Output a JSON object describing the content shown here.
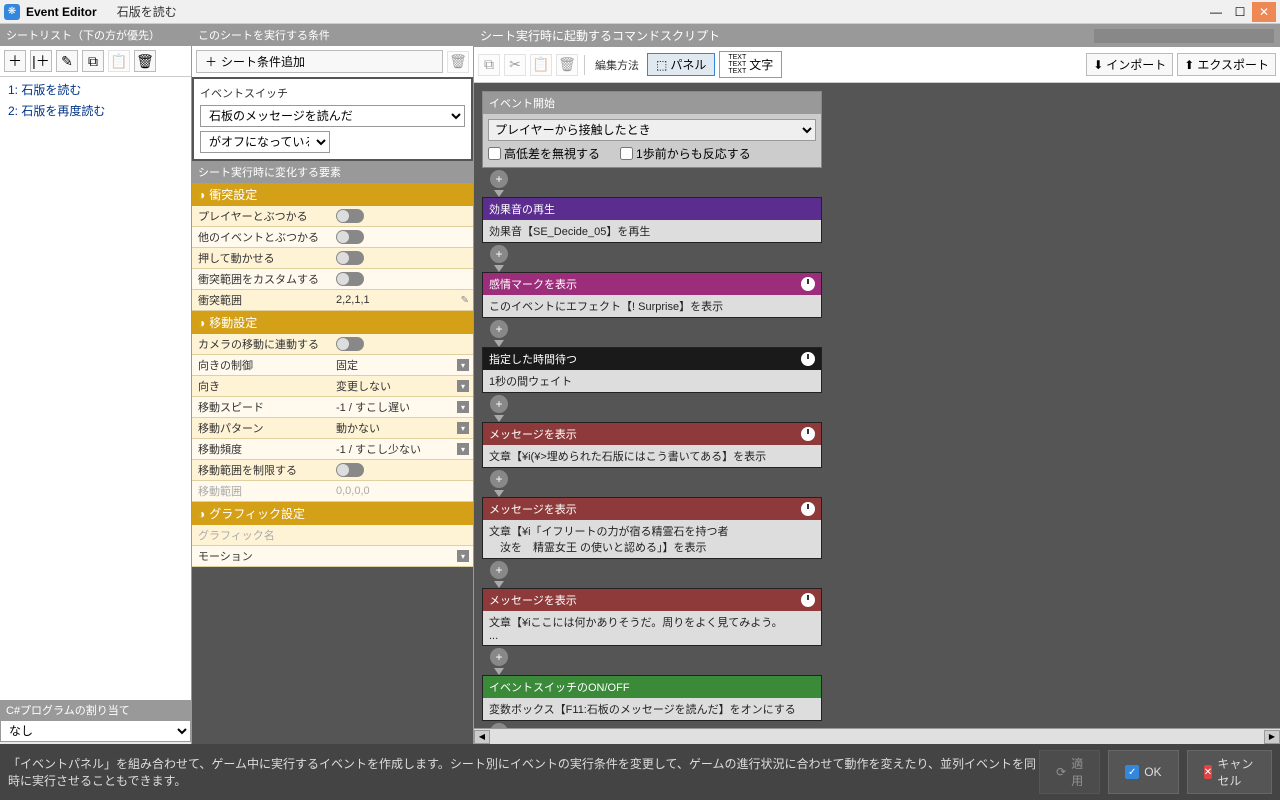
{
  "titlebar": {
    "app": "Event Editor",
    "event_name": "石版を読む"
  },
  "left": {
    "header": "シートリスト（下の方が優先）",
    "sheets": [
      {
        "idx": "1:",
        "name": "石版を読む"
      },
      {
        "idx": "2:",
        "name": "石版を再度読む"
      }
    ],
    "csharp_header": "C#プログラムの割り当て",
    "csharp_value": "なし"
  },
  "mid": {
    "cond_header": "このシートを実行する条件",
    "add_cond": "シート条件追加",
    "cond_box_label": "イベントスイッチ",
    "cond_switch": "石板のメッセージを読んだ",
    "cond_state": "がオフになっている",
    "change_header": "シート実行時に変化する要素",
    "collision_header": "衝突設定",
    "collision_rows": [
      {
        "label": "プレイヤーとぶつかる",
        "type": "toggle"
      },
      {
        "label": "他のイベントとぶつかる",
        "type": "toggle"
      },
      {
        "label": "押して動かせる",
        "type": "toggle"
      },
      {
        "label": "衝突範囲をカスタムする",
        "type": "toggle"
      },
      {
        "label": "衝突範囲",
        "type": "text",
        "value": "2,2,1,1"
      }
    ],
    "move_header": "移動設定",
    "move_rows": [
      {
        "label": "カメラの移動に連動する",
        "type": "toggle"
      },
      {
        "label": "向きの制御",
        "type": "dropdown",
        "value": "固定"
      },
      {
        "label": "向き",
        "type": "dropdown",
        "value": "変更しない"
      },
      {
        "label": "移動スピード",
        "type": "dropdown",
        "value": "-1 / すこし遅い"
      },
      {
        "label": "移動パターン",
        "type": "dropdown",
        "value": "動かない"
      },
      {
        "label": "移動頻度",
        "type": "dropdown",
        "value": "-1 / すこし少ない"
      },
      {
        "label": "移動範囲を制限する",
        "type": "toggle"
      },
      {
        "label": "移動範囲",
        "type": "text",
        "value": "0,0,0,0",
        "disabled": true
      }
    ],
    "graphic_header": "グラフィック設定",
    "graphic_rows": [
      {
        "label": "グラフィック名",
        "type": "text",
        "value": "",
        "disabled": true
      },
      {
        "label": "モーション",
        "type": "dropdown",
        "value": ""
      }
    ]
  },
  "right": {
    "header": "シート実行時に起動するコマンドスクリプト",
    "toolbar": {
      "edit_label": "編集方法",
      "tab_panel": "パネル",
      "tab_text": "文字",
      "import": "インポート",
      "export": "エクスポート"
    },
    "start": {
      "title": "イベント開始",
      "trigger": "プレイヤーから接触したとき",
      "cb1": "高低差を無視する",
      "cb2": "1歩前からも反応する"
    },
    "nodes": [
      {
        "color": "purple",
        "title": "効果音の再生",
        "body": "効果音【SE_Decide_05】を再生",
        "clock": false
      },
      {
        "color": "magenta",
        "title": "感情マークを表示",
        "body": "このイベントにエフェクト【! Surprise】を表示",
        "clock": true
      },
      {
        "color": "black",
        "title": "指定した時間待つ",
        "body": "1秒の間ウェイト",
        "clock": true
      },
      {
        "color": "red",
        "title": "メッセージを表示",
        "body": "文章【¥i(¥>埋められた石版にはこう書いてある】を表示",
        "clock": true
      },
      {
        "color": "red",
        "title": "メッセージを表示",
        "body": "文章【¥i「イフリートの力が宿る精霊石を持つ者\n　汝を　精霊女王 の使いと認める」】を表示",
        "clock": true
      },
      {
        "color": "red",
        "title": "メッセージを表示",
        "body": "文章【¥iここには何かありそうだ。周りをよく見てみよう。\n...",
        "clock": true
      },
      {
        "color": "green",
        "title": "イベントスイッチのON/OFF",
        "body": "変数ボックス【F11:石板のメッセージを読んだ】をオンにする",
        "clock": false
      }
    ]
  },
  "hint": "「イベントパネル」を組み合わせて、ゲーム中に実行するイベントを作成します。シート別にイベントの実行条件を変更して、ゲームの進行状況に合わせて動作を変えたり、並列イベントを同時に実行させることもできます。",
  "footer": {
    "apply": "適用",
    "ok": "OK",
    "cancel": "キャンセル"
  }
}
